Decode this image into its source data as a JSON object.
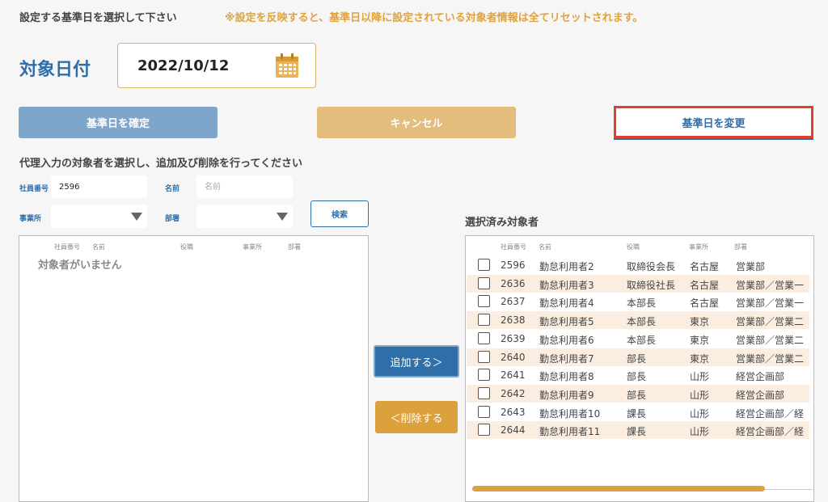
{
  "top": {
    "instruction": "設定する基準日を選択して下さい",
    "warning": "※設定を反映すると、基準日以降に設定されている対象者情報は全てリセットされます。"
  },
  "date": {
    "label": "対象日付",
    "value": "2022/10/12"
  },
  "buttons": {
    "confirm": "基準日を確定",
    "cancel": "キャンセル",
    "change": "基準日を変更",
    "search": "検索",
    "add": "追加する＞",
    "remove": "＜削除する"
  },
  "filter": {
    "heading": "代理入力の対象者を選択し、追加及び削除を行ってください",
    "employee_no_label": "社員番号",
    "employee_no_value": "2596",
    "name_label": "名前",
    "name_placeholder": "名前",
    "office_label": "事業所",
    "dept_label": "部署"
  },
  "left_list": {
    "columns": [
      "社員番号",
      "名前",
      "役職",
      "事業所",
      "部署"
    ],
    "empty_message": "対象者がいません"
  },
  "right_list": {
    "title": "選択済み対象者",
    "columns": [
      "社員番号",
      "名前",
      "役職",
      "事業所",
      "部署"
    ],
    "rows": [
      [
        "2596",
        "勤怠利用者2",
        "取締役会長",
        "名古屋",
        "営業部"
      ],
      [
        "2636",
        "勤怠利用者3",
        "取締役社長",
        "名古屋",
        "営業部／営業一"
      ],
      [
        "2637",
        "勤怠利用者4",
        "本部長",
        "名古屋",
        "営業部／営業一"
      ],
      [
        "2638",
        "勤怠利用者5",
        "本部長",
        "東京",
        "営業部／営業二"
      ],
      [
        "2639",
        "勤怠利用者6",
        "本部長",
        "東京",
        "営業部／営業二"
      ],
      [
        "2640",
        "勤怠利用者7",
        "部長",
        "東京",
        "営業部／営業二"
      ],
      [
        "2641",
        "勤怠利用者8",
        "部長",
        "山形",
        "経営企画部"
      ],
      [
        "2642",
        "勤怠利用者9",
        "部長",
        "山形",
        "経営企画部"
      ],
      [
        "2643",
        "勤怠利用者10",
        "課長",
        "山形",
        "経営企画部／経"
      ],
      [
        "2644",
        "勤怠利用者11",
        "課長",
        "山形",
        "経営企画部／経"
      ]
    ],
    "scroll_fraction": 0.86
  },
  "colors": {
    "accent_blue": "#2f6ea8",
    "accent_gold": "#dba13c",
    "alert_red": "#e0402b"
  }
}
